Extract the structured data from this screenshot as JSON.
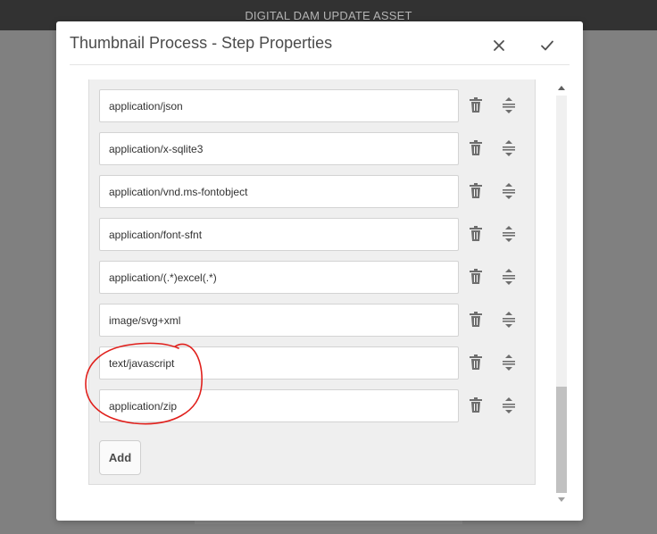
{
  "app": {
    "header_title": "DIGITAL DAM UPDATE ASSET"
  },
  "dialog": {
    "title": "Thumbnail Process - Step Properties",
    "close_icon": "close-icon",
    "done_icon": "checkmark-icon"
  },
  "mime_list": {
    "items": [
      {
        "value": "application/json"
      },
      {
        "value": "application/x-sqlite3"
      },
      {
        "value": "application/vnd.ms-fontobject"
      },
      {
        "value": "application/font-sfnt"
      },
      {
        "value": "application/(.*)excel(.*)"
      },
      {
        "value": "image/svg+xml"
      },
      {
        "value": "text/javascript"
      },
      {
        "value": "application/zip"
      }
    ],
    "add_label": "Add",
    "delete_icon": "trash-icon",
    "reorder_icon": "drag-handle-icon"
  },
  "colors": {
    "header_bg": "#323232",
    "overlay": "#808080",
    "annotation": "#e0201c"
  }
}
